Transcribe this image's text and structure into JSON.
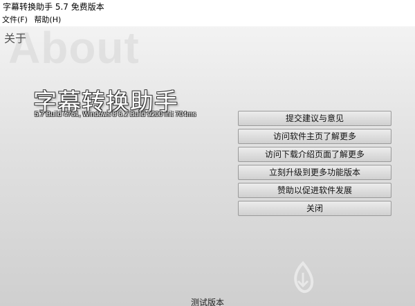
{
  "window": {
    "title": "字幕转换助手 5.7 免费版本"
  },
  "menu": {
    "items": [
      "文件(F)",
      "帮助(H)"
    ]
  },
  "about": {
    "section_label": "关于",
    "watermark": "About",
    "app_name": "字幕转换助手",
    "version": "5.7 Build 4761, Windows 8 6.2 Build 9200 init 704ms"
  },
  "actions": {
    "suggest": "提交建议与意见",
    "homepage": "访问软件主页了解更多",
    "download_page": "访问下载介绍页面了解更多",
    "upgrade": "立刻升级到更多功能版本",
    "sponsor": "赞助以促进软件发展",
    "close": "关闭"
  },
  "footer": {
    "text": "测试版本"
  },
  "colors": {
    "button_border": "#9a9a9a",
    "title_outline": "#333333"
  }
}
